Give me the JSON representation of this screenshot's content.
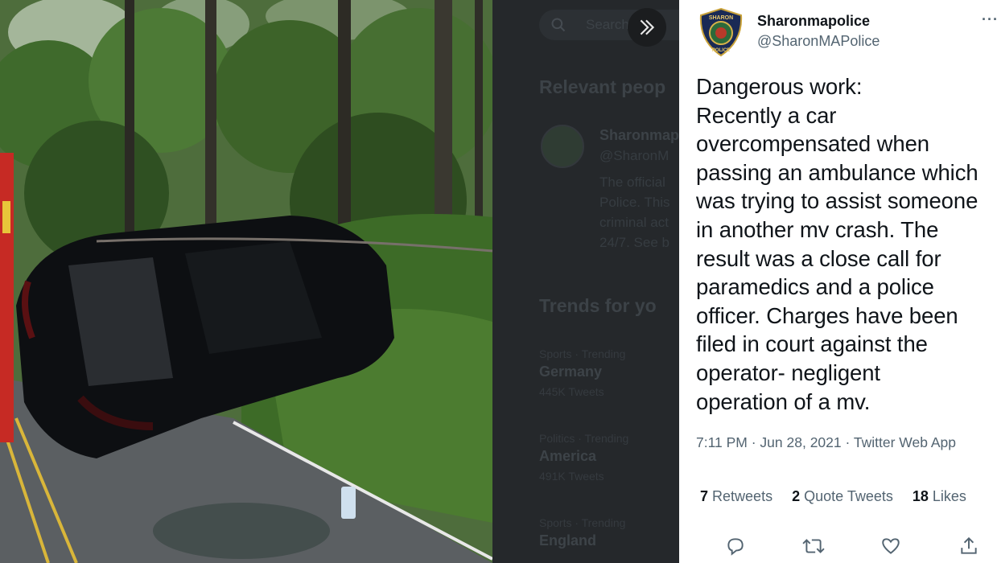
{
  "photo": {
    "alt": "Overturned black car on roadside"
  },
  "background_panel": {
    "search_placeholder": "Search",
    "relevant_heading": "Relevant peop",
    "person": {
      "name": "Sharonmap",
      "handle": "@SharonM",
      "bio_lines": [
        "The official",
        "Police. This",
        "criminal act",
        "24/7. See b"
      ]
    },
    "trends_heading": "Trends for yo",
    "trends": [
      {
        "category": "Sports · Trending",
        "name": "Germany",
        "count": "445K Tweets"
      },
      {
        "category": "Politics · Trending",
        "name": "America",
        "count": "491K Tweets"
      },
      {
        "category": "Sports · Trending",
        "name": "England",
        "count": ""
      }
    ]
  },
  "tweet": {
    "author": {
      "display_name": "Sharonmapolice",
      "handle": "@SharonMAPolice",
      "avatar_text_top": "SHARON",
      "avatar_text_bottom": "POLICE"
    },
    "text": "Dangerous work:\nRecently a car\novercompensated when\npassing an ambulance which\nwas trying to assist someone\nin another mv crash. The\nresult was a close call for\nparamedics and a police\nofficer. Charges have been\nfiled in court against the\noperator- negligent\noperation of a mv.",
    "timestamp": "7:11 PM · Jun 28, 2021 · Twitter Web App",
    "stats": {
      "retweets": {
        "count": "7",
        "label": "Retweets"
      },
      "quote_tweets": {
        "count": "2",
        "label": "Quote Tweets"
      },
      "likes": {
        "count": "18",
        "label": "Likes"
      }
    },
    "more_label": "···"
  },
  "icons": {
    "expand": "double-chevron-right-icon",
    "reply": "reply-icon",
    "retweet": "retweet-icon",
    "like": "heart-icon",
    "share": "share-icon"
  }
}
